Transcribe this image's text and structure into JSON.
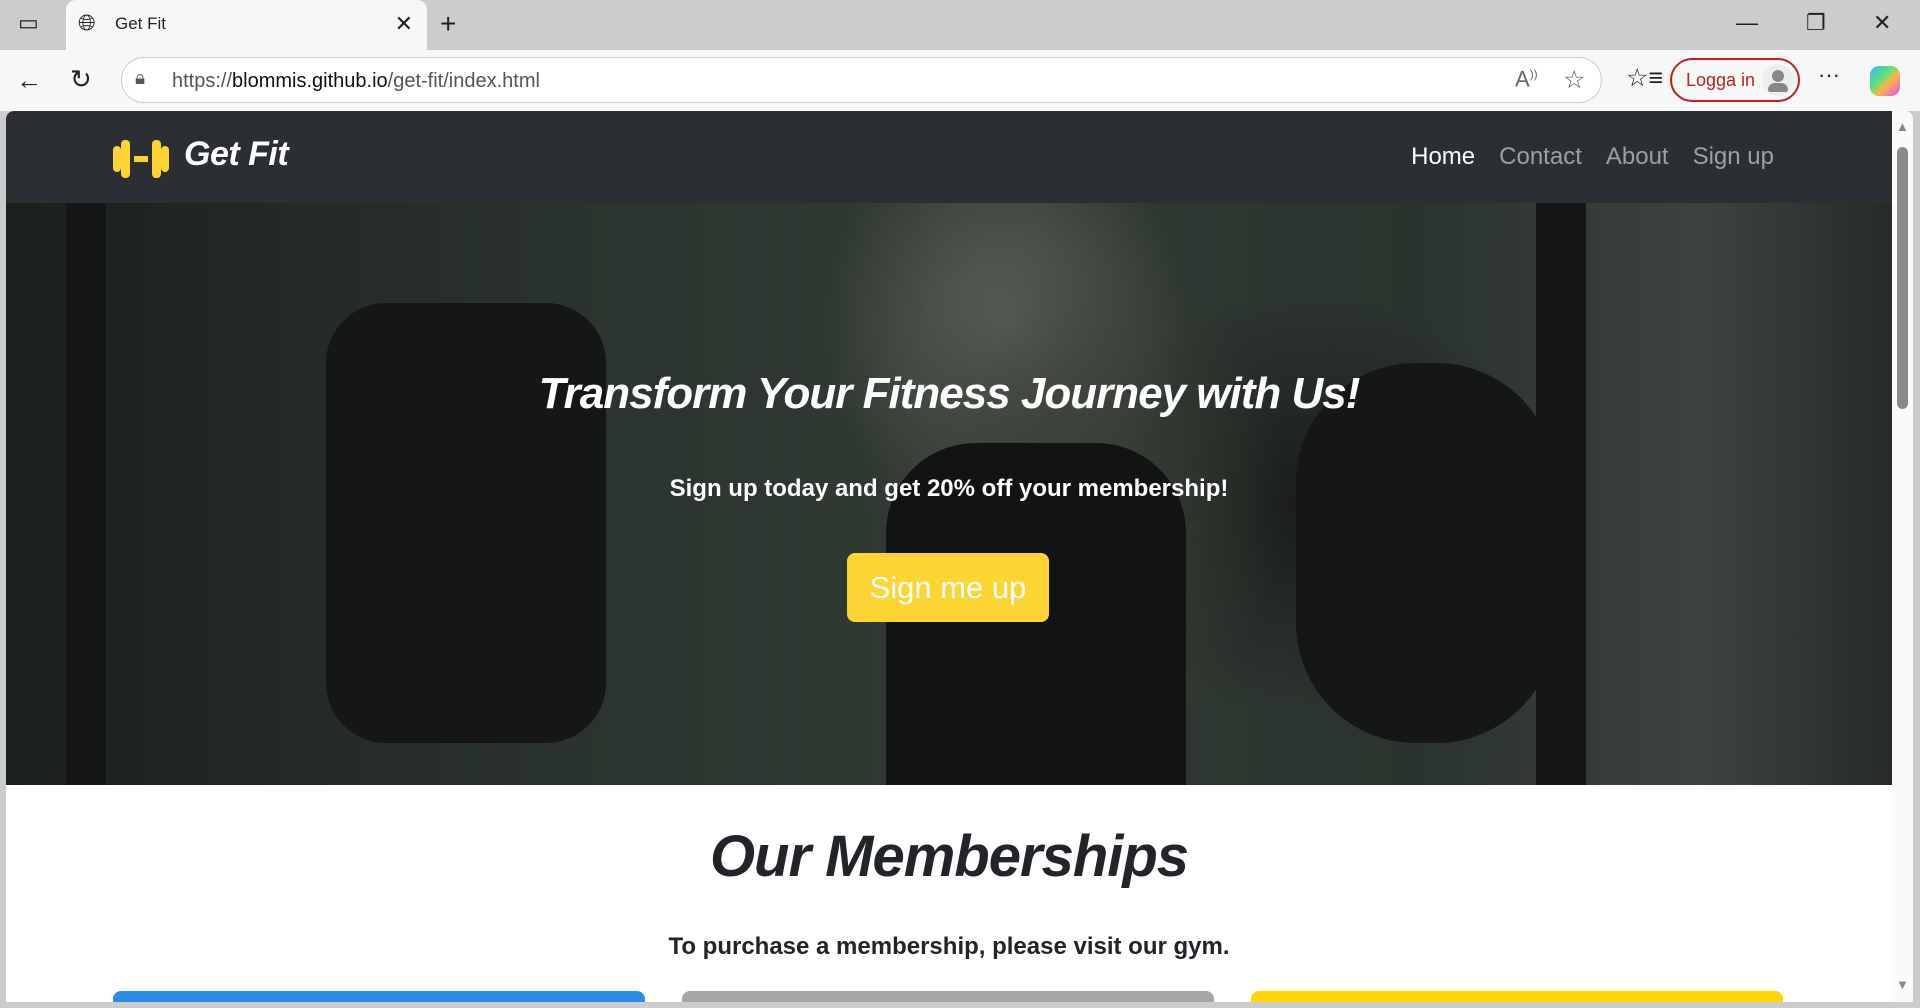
{
  "browser": {
    "tab_title": "Get Fit",
    "url_prefix": "https://",
    "url_domain": "blommis.github.io",
    "url_path": "/get-fit/index.html",
    "login_label": "Logga in"
  },
  "navbar": {
    "brand": "Get Fit",
    "links": [
      {
        "label": "Home",
        "active": true
      },
      {
        "label": "Contact"
      },
      {
        "label": "About"
      },
      {
        "label": "Sign up"
      }
    ]
  },
  "hero": {
    "headline": "Transform Your Fitness Journey with Us!",
    "subtext": "Sign up today and get 20% off your membership!",
    "button_label": "Sign me up"
  },
  "memberships": {
    "title": "Our Memberships",
    "note": "To purchase a membership, please visit our gym.",
    "card_colors": [
      "#2e8bec",
      "#a6a6a6",
      "#ffd700"
    ]
  },
  "colors": {
    "accent": "#fcd535",
    "navbar": "#2b2f33"
  }
}
